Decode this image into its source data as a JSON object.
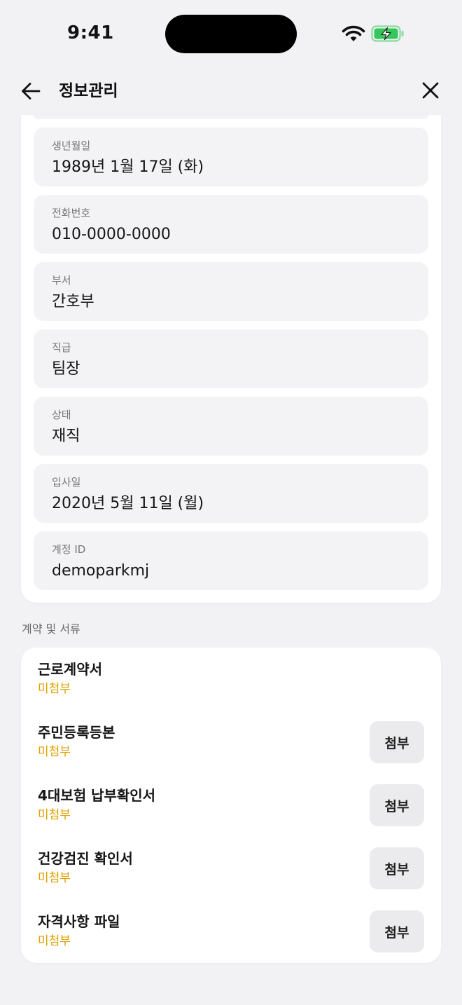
{
  "status_bar": {
    "time": "9:41"
  },
  "nav": {
    "title": "정보관리"
  },
  "info_fields": [
    {
      "label": "생년월일",
      "value": "1989년 1월 17일 (화)"
    },
    {
      "label": "전화번호",
      "value": "010-0000-0000"
    },
    {
      "label": "부서",
      "value": "간호부"
    },
    {
      "label": "직급",
      "value": "팀장"
    },
    {
      "label": "상태",
      "value": "재직"
    },
    {
      "label": "입사일",
      "value": "2020년 5월 11일 (월)"
    },
    {
      "label": "계정 ID",
      "value": "demoparkmj"
    }
  ],
  "documents": {
    "section_title": "계약 및 서류",
    "attach_label": "첨부",
    "items": [
      {
        "name": "근로계약서",
        "status": "미첨부",
        "has_attach_button": false
      },
      {
        "name": "주민등록등본",
        "status": "미첨부",
        "has_attach_button": true
      },
      {
        "name": "4대보험 납부확인서",
        "status": "미첨부",
        "has_attach_button": true
      },
      {
        "name": "건강검진 확인서",
        "status": "미첨부",
        "has_attach_button": true
      },
      {
        "name": "자격사항 파일",
        "status": "미첨부",
        "has_attach_button": true
      }
    ]
  },
  "colors": {
    "background": "#f2f2f4",
    "card": "#ffffff",
    "field_bg": "#f3f3f5",
    "status_pending": "#e0a100",
    "battery_green": "#34c759"
  },
  "icons": {
    "back": "arrow-left-icon",
    "close": "close-icon",
    "wifi": "wifi-icon",
    "battery": "battery-charging-icon"
  }
}
